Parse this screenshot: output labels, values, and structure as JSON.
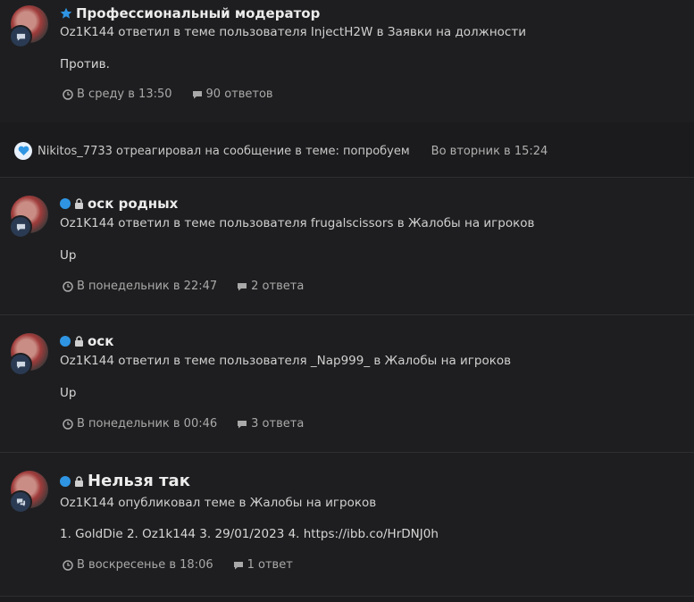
{
  "colors": {
    "background": "#1e1e20",
    "accent_blue": "#2f95e3",
    "text": "#d4d4d4",
    "muted": "#a9a9a9"
  },
  "items": [
    {
      "title": "Профессиональный модератор",
      "prefix_icon": "star-icon",
      "line": "Oz1K144 ответил в теме пользователя InjectH2W в Заявки на должности",
      "body": "Против.",
      "time": "В среду в 13:50",
      "replies": "90 ответов",
      "badge_icon": "comment-icon"
    },
    {
      "title": "оск родных",
      "prefix_icon": "lock-icon",
      "line": "Oz1K144 ответил в теме пользователя frugalscissors в Жалобы на игроков",
      "body": "Up",
      "time": "В понедельник в 22:47",
      "replies": "2 ответа",
      "badge_icon": "comment-icon"
    },
    {
      "title": "оск",
      "prefix_icon": "lock-icon",
      "line": "Oz1K144 ответил в теме пользователя _Nap999_ в Жалобы на игроков",
      "body": "Up",
      "time": "В понедельник в 00:46",
      "replies": "3 ответа",
      "badge_icon": "comment-icon"
    },
    {
      "title": "Нельзя так",
      "prefix_icon": "lock-icon",
      "line": "Oz1K144 опубликовал теме в Жалобы на игроков",
      "body": "1. GoldDie 2. Oz1k144 3. 29/01/2023 4. https://ibb.co/HrDNJ0h",
      "time": "В воскресенье в 18:06",
      "replies": "1 ответ",
      "badge_icon": "comments-icon"
    }
  ],
  "reaction": {
    "text": "Nikitos_7733 отреагировал на сообщение в теме: попробуем",
    "time": "Во вторник в 15:24",
    "icon": "heart-icon"
  }
}
